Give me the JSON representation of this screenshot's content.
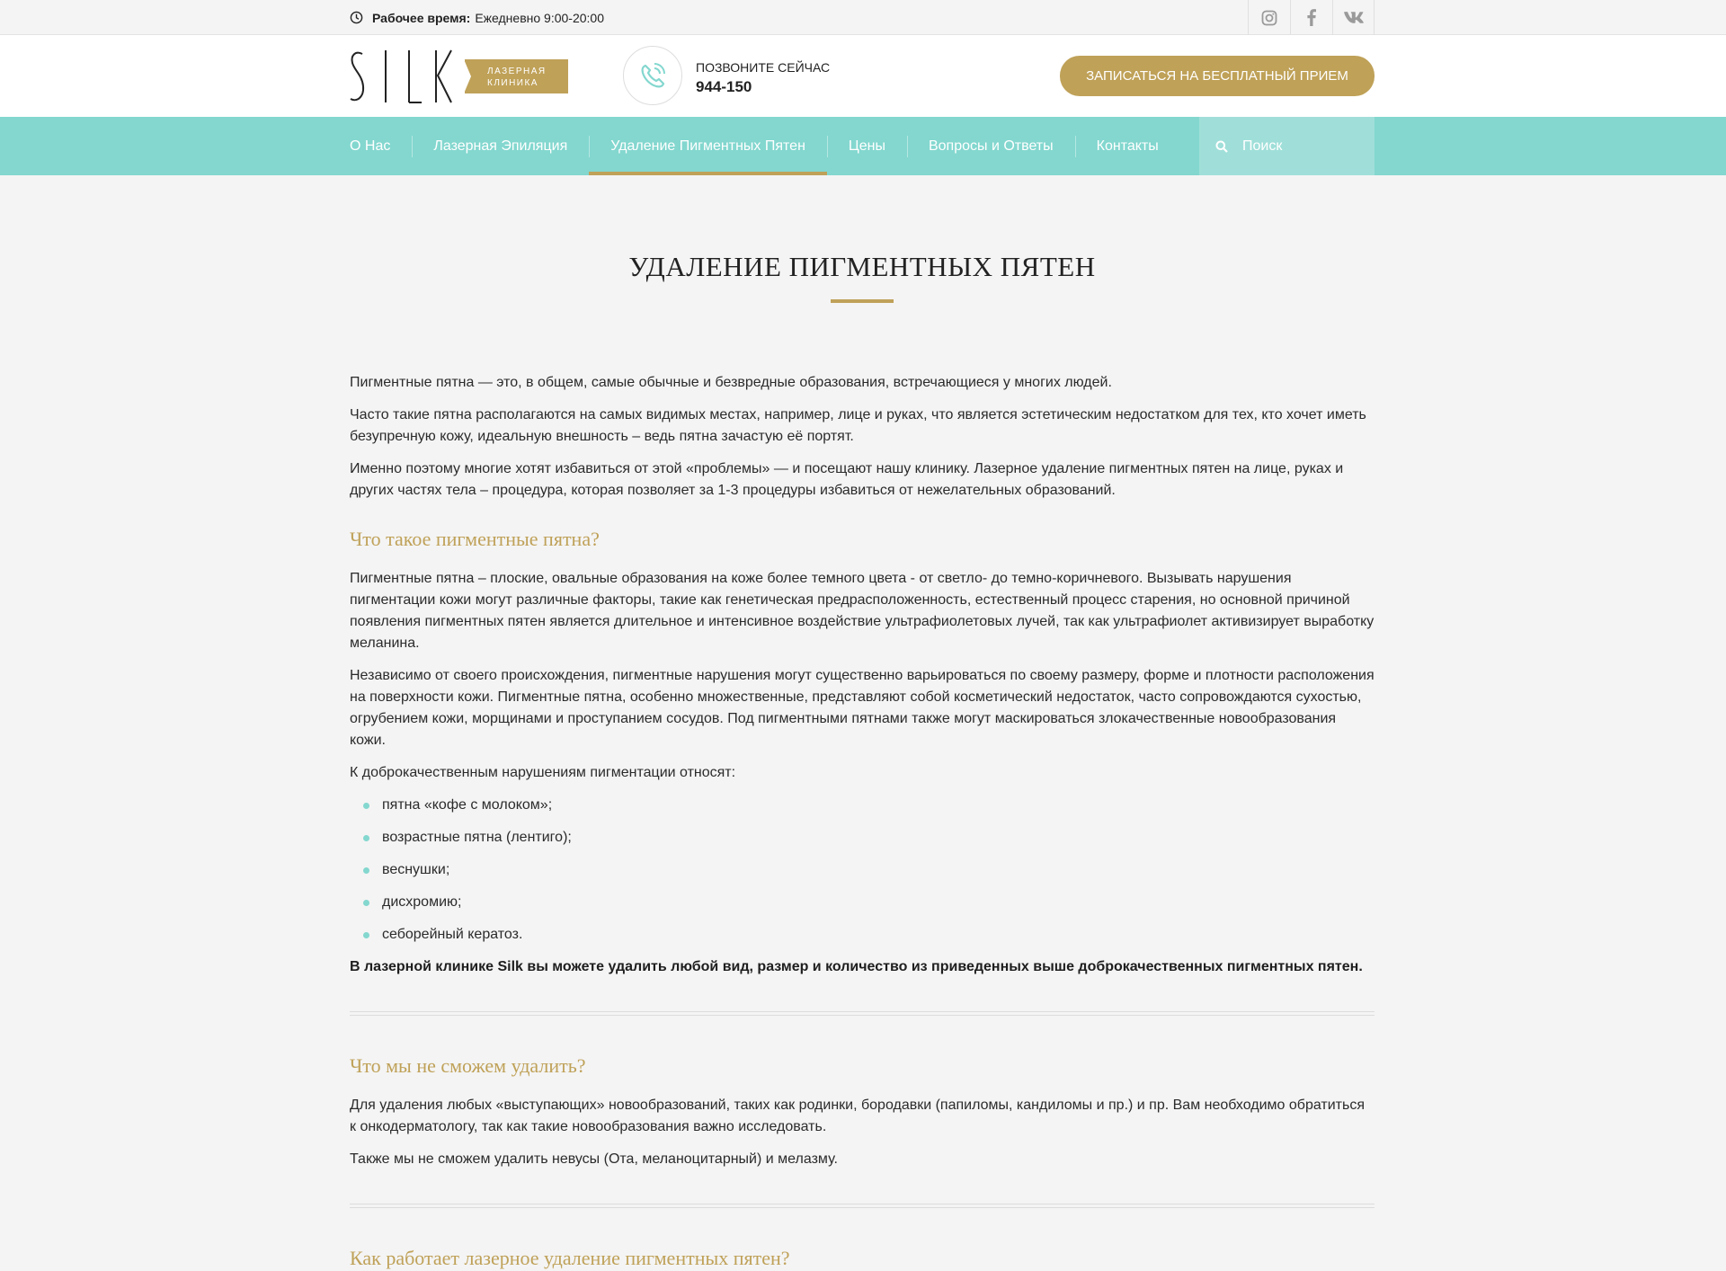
{
  "topbar": {
    "hours_label": "Рабочее время:",
    "hours_value": "Ежедневно 9:00-20:00",
    "socials": [
      "instagram-icon",
      "facebook-icon",
      "vk-icon"
    ]
  },
  "header": {
    "logo_text": "SILK",
    "logo_badge_line1": "ЛАЗЕРНАЯ",
    "logo_badge_line2": "КЛИНИКА",
    "phone_label": "ПОЗВОНИТЕ СЕЙЧАС",
    "phone_number": "944-150",
    "cta_label": "ЗАПИСАТЬСЯ НА БЕСПЛАТНЫЙ ПРИЕМ"
  },
  "nav": {
    "items": [
      "О Нас",
      "Лазерная Эпиляция",
      "Удаление Пигментных Пятен",
      "Цены",
      "Вопросы и Ответы",
      "Контакты"
    ],
    "active_index": 2,
    "search_placeholder": "Поиск"
  },
  "colors": {
    "accent_gold": "#bfa158",
    "nav_teal": "#83d7cf",
    "search_teal": "#a0dfd9"
  },
  "main": {
    "title": "УДАЛЕНИЕ ПИГМЕНТНЫХ ПЯТЕН",
    "intro": [
      "Пигментные пятна — это, в общем, самые обычные и безвредные образования, встречающиеся у многих людей.",
      "Часто такие пятна располагаются на самых видимых местах, например, лице и руках, что является эстетическим недостатком для тех, кто хочет иметь безупречную кожу, идеальную внешность – ведь пятна зачастую её портят.",
      "Именно поэтому многие хотят избавиться от этой «проблемы» — и посещают нашу клинику. Лазерное удаление пигментных пятен на лице, руках и других частях тела – процедура, которая позволяет за 1-3 процедуры избавиться от нежелательных образований."
    ],
    "section1": {
      "heading": "Что такое пигментные пятна?",
      "paragraphs": [
        "Пигментные пятна – плоские, овальные образования на коже более темного цвета - от светло- до темно-коричневого. Вызывать нарушения пигментации кожи могут различные факторы, такие как генетическая предрасположенность, естественный процесс старения, но основной причиной появления пигментных пятен является длительное и интенсивное воздействие ультрафиолетовых лучей, так как ультрафиолет активизирует выработку меланина.",
        "Независимо от своего происхождения, пигментные нарушения могут существенно варьироваться по своему размеру, форме и плотности расположения на поверхности кожи. Пигментные пятна, особенно множественные, представляют собой косметический недостаток, часто сопровождаются сухостью, огрубением кожи, морщинами и проступанием сосудов. Под пигментными пятнами также могут маскироваться злокачественные новообразования кожи.",
        "К доброкачественным нарушениям пигментации относят:"
      ],
      "list": [
        "пятна «кофе с молоком»;",
        "возрастные пятна (лентиго);",
        "веснушки;",
        "дисхромию;",
        "себорейный кератоз."
      ],
      "bold_note": "В лазерной клинике Silk вы можете удалить любой вид, размер и количество из приведенных выше доброкачественных пигментных пятен."
    },
    "section2": {
      "heading": "Что мы не сможем удалить?",
      "paragraphs": [
        "Для удаления любых «выступающих» новообразований, таких как родинки, бородавки (папиломы, кандиломы и пр.) и пр. Вам необходимо обратиться к онкодерматологу, так как такие новообразования важно исследовать.",
        "Также мы не сможем удалить невусы (Ота, меланоцитарный) и мелазму."
      ]
    },
    "section3": {
      "heading": "Как работает лазерное удаление пигментных пятен?"
    }
  }
}
